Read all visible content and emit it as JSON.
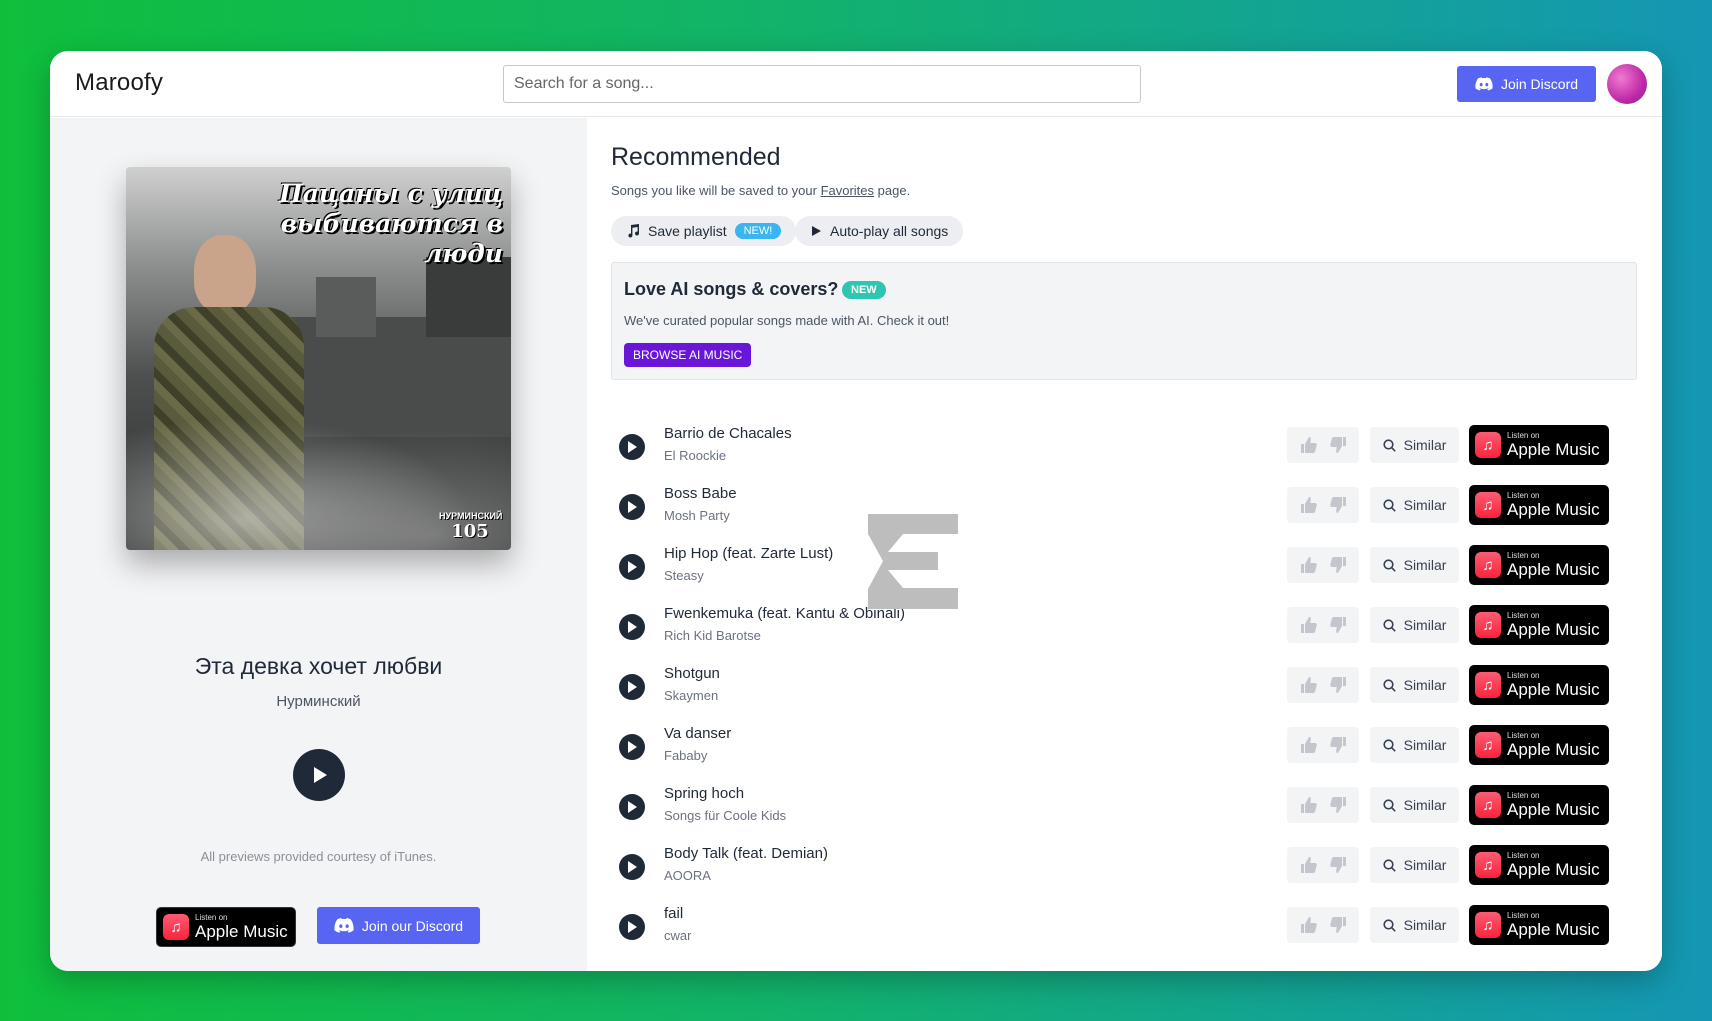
{
  "header": {
    "brand": "Maroofy",
    "search_placeholder": "Search for a song...",
    "discord_label": "Join Discord"
  },
  "now_playing": {
    "cover_title": "Пацаны с улиц выбиваются в люди",
    "cover_badge_top": "НУРМИНСКИЙ",
    "cover_badge_num": "105",
    "title": "Эта девка хочет любви",
    "artist": "Нурминский",
    "courtesy": "All previews provided courtesy of iTunes.",
    "discord_label": "Join our Discord"
  },
  "apple_music": {
    "small": "Listen on",
    "big": "Apple Music"
  },
  "recommended": {
    "title": "Recommended",
    "subtitle_pre": "Songs you like will be saved to your ",
    "subtitle_link": "Favorites",
    "subtitle_post": " page.",
    "save_playlist": "Save playlist",
    "save_new": "NEW!",
    "autoplay": "Auto-play all songs"
  },
  "ai_box": {
    "title": "Love AI songs & covers?",
    "badge": "NEW",
    "description": "We've curated popular songs made with AI. Check it out!",
    "button": "BROWSE AI MUSIC"
  },
  "similar_label": "Similar",
  "songs": [
    {
      "title": "Barrio de Chacales",
      "artist": "El Roockie"
    },
    {
      "title": "Boss Babe",
      "artist": "Mosh Party"
    },
    {
      "title": "Hip Hop (feat. Zarte Lust)",
      "artist": "Steasy"
    },
    {
      "title": "Fwenkemuka (feat. Kantu & Obinali)",
      "artist": "Rich Kid Barotse"
    },
    {
      "title": "Shotgun",
      "artist": "Skaymen"
    },
    {
      "title": "Va danser",
      "artist": "Fababy"
    },
    {
      "title": "Spring hoch",
      "artist": "Songs für Coole Kids"
    },
    {
      "title": "Body Talk (feat. Demian)",
      "artist": "AOORA"
    },
    {
      "title": "fail",
      "artist": "cwar"
    }
  ],
  "colors": {
    "discord": "#5865f2",
    "ai_button": "#6a16d9",
    "new_badge": "#2ec6b0",
    "dark": "#1f2937"
  },
  "icons": [
    "discord-icon",
    "music-note-icon",
    "play-icon",
    "thumbs-up-icon",
    "thumbs-down-icon",
    "search-icon",
    "apple-music-icon"
  ]
}
